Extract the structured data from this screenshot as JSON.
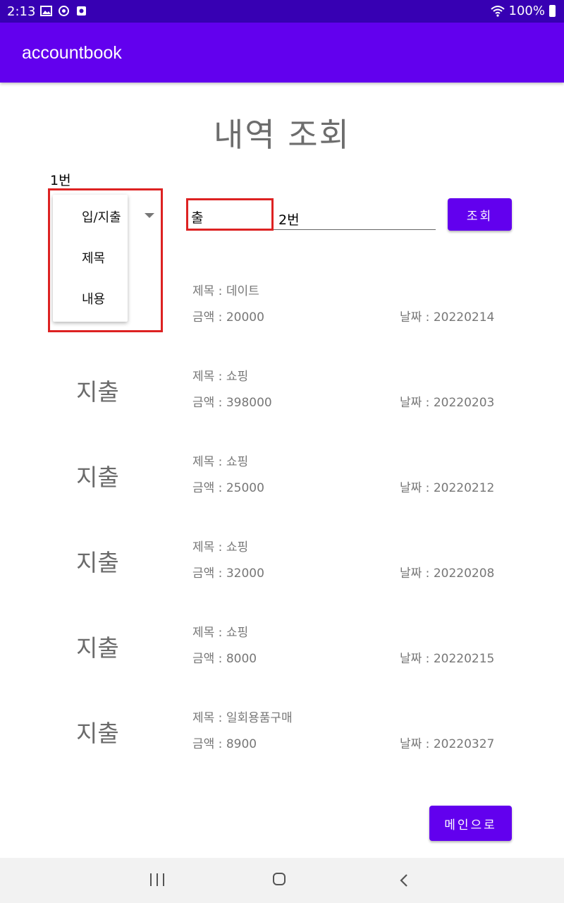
{
  "status_bar": {
    "time": "2:13",
    "battery": "100%"
  },
  "app_bar": {
    "title": "accountbook"
  },
  "page_title": "내역 조회",
  "annotations": {
    "label_1": "1번",
    "label_2": "2번"
  },
  "filter": {
    "dropdown_options": [
      "입/지출",
      "제목",
      "내용"
    ],
    "search_value": "출",
    "search_button": "조회"
  },
  "records": [
    {
      "type": "",
      "title": "제목 : 데이트",
      "amount": "금액 : 20000",
      "date": "날짜 : 20220214"
    },
    {
      "type": "지출",
      "title": "제목 : 쇼핑",
      "amount": "금액 : 398000",
      "date": "날짜 : 20220203"
    },
    {
      "type": "지출",
      "title": "제목 : 쇼핑",
      "amount": "금액 : 25000",
      "date": "날짜 : 20220212"
    },
    {
      "type": "지출",
      "title": "제목 : 쇼핑",
      "amount": "금액 : 32000",
      "date": "날짜 : 20220208"
    },
    {
      "type": "지출",
      "title": "제목 : 쇼핑",
      "amount": "금액 : 8000",
      "date": "날짜 : 20220215"
    },
    {
      "type": "지출",
      "title": "제목 : 일회용품구매",
      "amount": "금액 : 8900",
      "date": "날짜 : 20220327"
    }
  ],
  "main_button": "메인으로",
  "colors": {
    "primary": "#6200EE",
    "primary_dark": "#3700B3",
    "highlight": "#dd2222"
  }
}
